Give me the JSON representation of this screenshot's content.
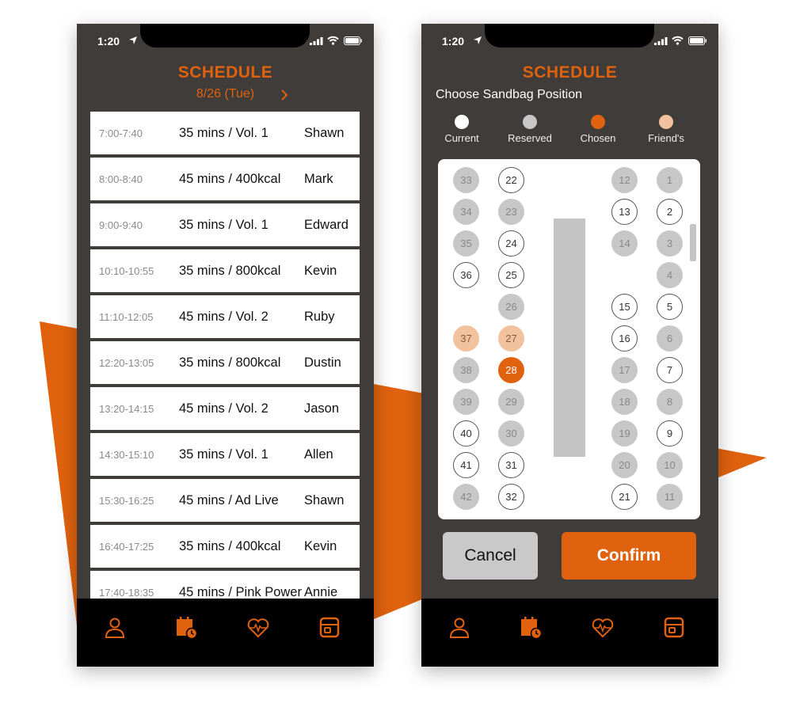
{
  "status_bar": {
    "time": "1:20"
  },
  "schedule_screen": {
    "title": "SCHEDULE",
    "date": "8/26 (Tue)",
    "rows": [
      {
        "time": "7:00-7:40",
        "class": "35 mins / Vol. 1",
        "coach": "Shawn"
      },
      {
        "time": "8:00-8:40",
        "class": "45 mins / 400kcal",
        "coach": "Mark"
      },
      {
        "time": "9:00-9:40",
        "class": "35 mins / Vol. 1",
        "coach": "Edward"
      },
      {
        "time": "10:10-10:55",
        "class": "35 mins / 800kcal",
        "coach": "Kevin"
      },
      {
        "time": "11:10-12:05",
        "class": "45 mins / Vol. 2",
        "coach": "Ruby"
      },
      {
        "time": "12:20-13:05",
        "class": "35 mins / 800kcal",
        "coach": "Dustin"
      },
      {
        "time": "13:20-14:15",
        "class": "45 mins / Vol. 2",
        "coach": "Jason"
      },
      {
        "time": "14:30-15:10",
        "class": "35 mins / Vol. 1",
        "coach": "Allen"
      },
      {
        "time": "15:30-16:25",
        "class": "45 mins / Ad Live",
        "coach": "Shawn"
      },
      {
        "time": "16:40-17:25",
        "class": "35 mins / 400kcal",
        "coach": "Kevin"
      },
      {
        "time": "17:40-18:35",
        "class": "45 mins / Pink Power",
        "coach": "Annie"
      }
    ]
  },
  "sandbag_screen": {
    "title": "SCHEDULE",
    "subtitle": "Choose Sandbag Position",
    "legend": [
      {
        "label": "Current",
        "color": "#ffffff"
      },
      {
        "label": "Reserved",
        "color": "#c7c7c7"
      },
      {
        "label": "Chosen",
        "color": "#e0620e"
      },
      {
        "label": "Friend's",
        "color": "#f2c19d"
      }
    ],
    "columns": [
      {
        "seats": [
          {
            "n": "33",
            "s": "reserved"
          },
          {
            "n": "34",
            "s": "reserved"
          },
          {
            "n": "35",
            "s": "reserved"
          },
          {
            "n": "36",
            "s": "current"
          },
          null,
          {
            "n": "37",
            "s": "friend"
          },
          {
            "n": "38",
            "s": "reserved"
          },
          {
            "n": "39",
            "s": "reserved"
          },
          {
            "n": "40",
            "s": "current"
          },
          {
            "n": "41",
            "s": "current"
          },
          {
            "n": "42",
            "s": "reserved"
          }
        ]
      },
      {
        "seats": [
          {
            "n": "22",
            "s": "current"
          },
          {
            "n": "23",
            "s": "reserved"
          },
          {
            "n": "24",
            "s": "current"
          },
          {
            "n": "25",
            "s": "current"
          },
          {
            "n": "26",
            "s": "reserved"
          },
          {
            "n": "27",
            "s": "friend"
          },
          {
            "n": "28",
            "s": "chosen"
          },
          {
            "n": "29",
            "s": "reserved"
          },
          {
            "n": "30",
            "s": "reserved"
          },
          {
            "n": "31",
            "s": "current"
          },
          {
            "n": "32",
            "s": "current"
          }
        ]
      },
      {
        "seats": [
          {
            "n": "12",
            "s": "reserved"
          },
          {
            "n": "13",
            "s": "current"
          },
          {
            "n": "14",
            "s": "reserved"
          },
          null,
          {
            "n": "15",
            "s": "current"
          },
          {
            "n": "16",
            "s": "current"
          },
          {
            "n": "17",
            "s": "reserved"
          },
          {
            "n": "18",
            "s": "reserved"
          },
          {
            "n": "19",
            "s": "reserved"
          },
          {
            "n": "20",
            "s": "reserved"
          },
          {
            "n": "21",
            "s": "current"
          }
        ]
      },
      {
        "seats": [
          {
            "n": "1",
            "s": "reserved"
          },
          {
            "n": "2",
            "s": "current"
          },
          {
            "n": "3",
            "s": "reserved"
          },
          {
            "n": "4",
            "s": "reserved"
          },
          {
            "n": "5",
            "s": "current"
          },
          {
            "n": "6",
            "s": "reserved"
          },
          {
            "n": "7",
            "s": "current"
          },
          {
            "n": "8",
            "s": "reserved"
          },
          {
            "n": "9",
            "s": "current"
          },
          {
            "n": "10",
            "s": "reserved"
          },
          {
            "n": "11",
            "s": "reserved"
          }
        ]
      }
    ],
    "cancel_label": "Cancel",
    "confirm_label": "Confirm"
  },
  "tabbar": [
    {
      "icon": "profile-icon"
    },
    {
      "icon": "schedule-calendar-icon"
    },
    {
      "icon": "heart-rate-icon"
    },
    {
      "icon": "boxing-sandbag-icon"
    }
  ],
  "colors": {
    "accent": "#e0620e",
    "phone_bg": "#3f3c3a",
    "tabbar_bg": "#000000"
  }
}
